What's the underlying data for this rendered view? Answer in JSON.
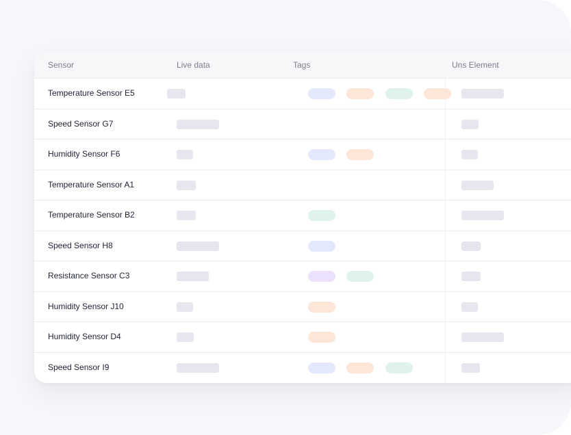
{
  "columns": {
    "sensor": "Sensor",
    "live_data": "Live data",
    "tags": "Tags",
    "uns_element": "Uns Element"
  },
  "colors": {
    "tag_blue": "#e3e8fd",
    "tag_orange": "#fde6d7",
    "tag_teal": "#dff2ee",
    "tag_purple": "#ece1fd",
    "skeleton": "#e5e6ee"
  },
  "rows": [
    {
      "sensor": "Temperature Sensor E5",
      "tags": [
        "blue",
        "orange",
        "teal",
        "orange"
      ]
    },
    {
      "sensor": "Speed Sensor G7",
      "tags": []
    },
    {
      "sensor": "Humidity Sensor F6",
      "tags": [
        "blue",
        "orange"
      ]
    },
    {
      "sensor": "Temperature Sensor A1",
      "tags": []
    },
    {
      "sensor": "Temperature Sensor B2",
      "tags": [
        "teal"
      ]
    },
    {
      "sensor": "Speed Sensor H8",
      "tags": [
        "blue"
      ]
    },
    {
      "sensor": "Resistance Sensor C3",
      "tags": [
        "purple",
        "teal"
      ]
    },
    {
      "sensor": "Humidity Sensor J10",
      "tags": [
        "orange"
      ]
    },
    {
      "sensor": "Humidity Sensor D4",
      "tags": [
        "orange"
      ]
    },
    {
      "sensor": "Speed Sensor I9",
      "tags": [
        "blue",
        "orange",
        "teal"
      ]
    }
  ]
}
